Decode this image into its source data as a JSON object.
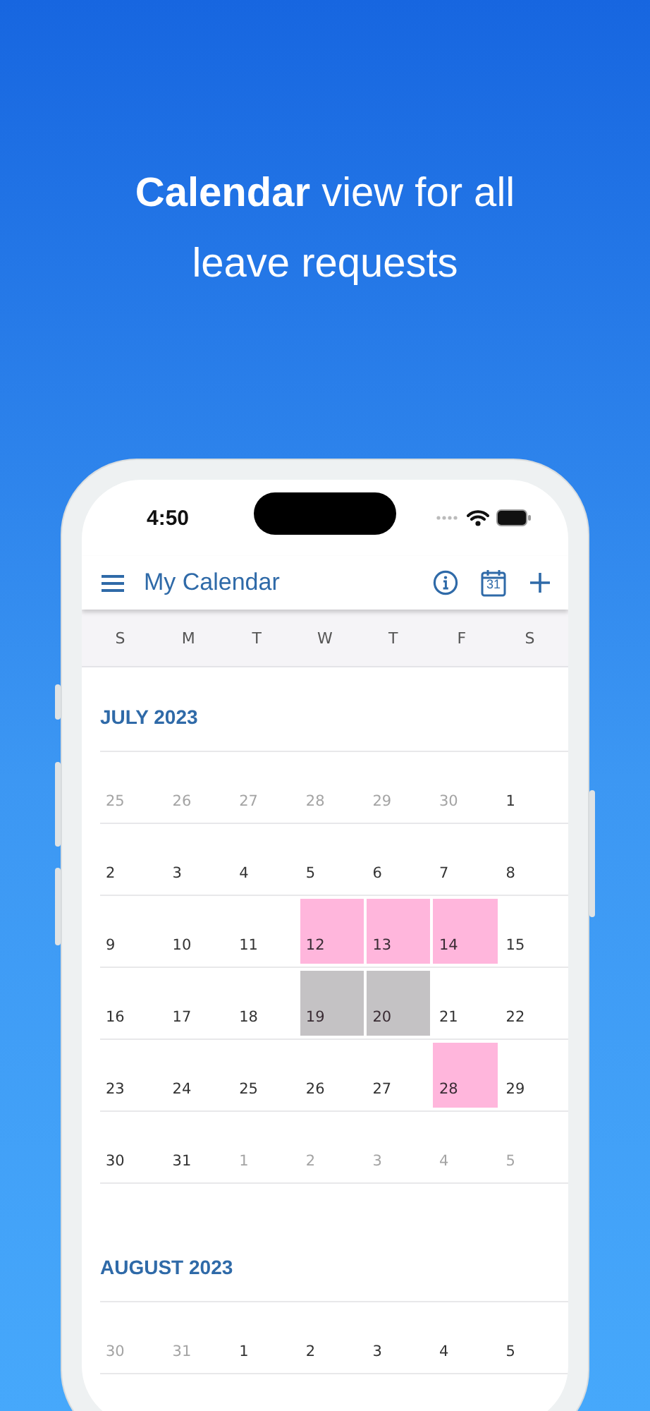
{
  "headline": "**Calendar** view for all leave requests",
  "status_bar": {
    "time": "4:50"
  },
  "app_bar": {
    "title": "My Calendar",
    "actions": [
      {
        "kind": "info"
      },
      {
        "kind": "calendar",
        "label": "31"
      },
      {
        "kind": "add"
      }
    ]
  },
  "weekdays": [
    "S",
    "M",
    "T",
    "W",
    "T",
    "F",
    "S"
  ],
  "months": [
    {
      "title": "JULY 2023",
      "weeks": [
        [
          {
            "day": "25",
            "muted": true
          },
          {
            "day": "26",
            "muted": true
          },
          {
            "day": "27",
            "muted": true
          },
          {
            "day": "28",
            "muted": true
          },
          {
            "day": "29",
            "muted": true
          },
          {
            "day": "30",
            "muted": true
          },
          {
            "day": "1",
            "muted": false
          }
        ],
        [
          {
            "day": "2",
            "muted": false
          },
          {
            "day": "3",
            "muted": false
          },
          {
            "day": "4",
            "muted": false
          },
          {
            "day": "5",
            "muted": false
          },
          {
            "day": "6",
            "muted": false
          },
          {
            "day": "7",
            "muted": false
          },
          {
            "day": "8",
            "muted": false
          }
        ],
        [
          {
            "day": "9",
            "muted": false
          },
          {
            "day": "10",
            "muted": false
          },
          {
            "day": "11",
            "muted": false
          },
          {
            "day": "12",
            "muted": false,
            "color": "#ffb6dc"
          },
          {
            "day": "13",
            "muted": false,
            "color": "#ffb6dc"
          },
          {
            "day": "14",
            "muted": false,
            "color": "#ffb6dc"
          },
          {
            "day": "15",
            "muted": false
          }
        ],
        [
          {
            "day": "16",
            "muted": false
          },
          {
            "day": "17",
            "muted": false
          },
          {
            "day": "18",
            "muted": false
          },
          {
            "day": "19",
            "muted": false,
            "color": "#c4c2c4"
          },
          {
            "day": "20",
            "muted": false,
            "color": "#c4c2c4"
          },
          {
            "day": "21",
            "muted": false
          },
          {
            "day": "22",
            "muted": false
          }
        ],
        [
          {
            "day": "23",
            "muted": false
          },
          {
            "day": "24",
            "muted": false
          },
          {
            "day": "25",
            "muted": false
          },
          {
            "day": "26",
            "muted": false
          },
          {
            "day": "27",
            "muted": false
          },
          {
            "day": "28",
            "muted": false,
            "color": "#ffb6dc"
          },
          {
            "day": "29",
            "muted": false
          }
        ],
        [
          {
            "day": "30",
            "muted": false
          },
          {
            "day": "31",
            "muted": false
          },
          {
            "day": "1",
            "muted": true
          },
          {
            "day": "2",
            "muted": true
          },
          {
            "day": "3",
            "muted": true
          },
          {
            "day": "4",
            "muted": true
          },
          {
            "day": "5",
            "muted": true
          }
        ]
      ]
    },
    {
      "title": "AUGUST 2023",
      "weeks": [
        [
          {
            "day": "30",
            "muted": true
          },
          {
            "day": "31",
            "muted": true
          },
          {
            "day": "1",
            "muted": false
          },
          {
            "day": "2",
            "muted": false
          },
          {
            "day": "3",
            "muted": false
          },
          {
            "day": "4",
            "muted": false
          },
          {
            "day": "5",
            "muted": false
          }
        ]
      ]
    }
  ]
}
